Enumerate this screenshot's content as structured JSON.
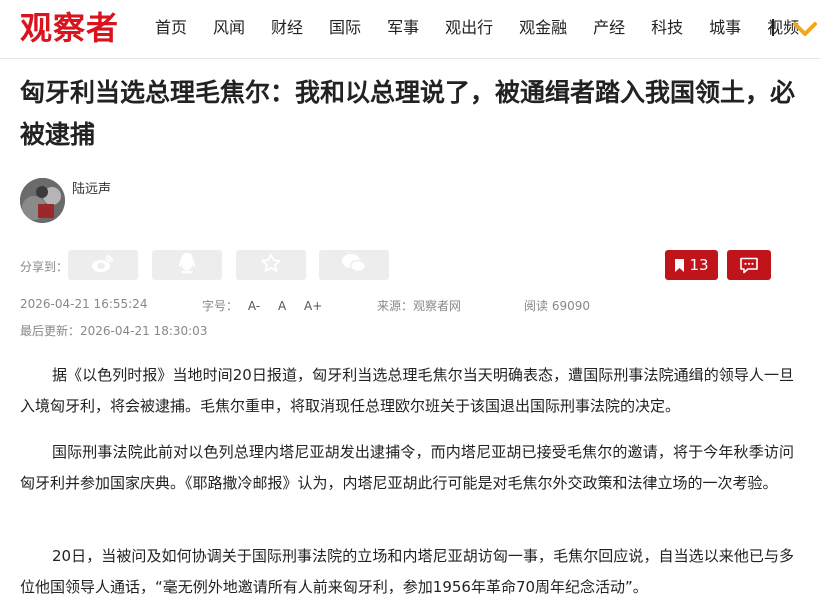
{
  "site": {
    "logo": "观察者"
  },
  "nav": {
    "items": [
      "首页",
      "风闻",
      "财经",
      "国际",
      "军事",
      "观出行",
      "观金融",
      "产经",
      "科技",
      "城事",
      "视频"
    ]
  },
  "article": {
    "title": "匈牙利当选总理毛焦尔：我和以总理说了，被通缉者踏入我国领土，必被逮捕",
    "author": "陆远声",
    "share_label": "分享到：",
    "bookmark_count": "13",
    "publish_time": "2026-04-21 16:55:24",
    "font_size_label": "字号：",
    "font_small": "A-",
    "font_normal": "A",
    "font_large": "A+",
    "source": "来源：观察者网",
    "reads": "阅读 69090",
    "updated": "最后更新：2026-04-21 18:30:03",
    "paragraphs": [
      "据《以色列时报》当地时间20日报道，匈牙利当选总理毛焦尔当天明确表态，遭国际刑事法院通缉的领导人一旦入境匈牙利，将会被逮捕。毛焦尔重申，将取消现任总理欧尔班关于该国退出国际刑事法院的决定。",
      "国际刑事法院此前对以色列总理内塔尼亚胡发出逮捕令，而内塔尼亚胡已接受毛焦尔的邀请，将于今年秋季访问匈牙利并参加国家庆典。《耶路撒冷邮报》认为，内塔尼亚胡此行可能是对毛焦尔外交政策和法律立场的一次考验。",
      "20日，当被问及如何协调关于国际刑事法院的立场和内塔尼亚胡访匈一事，毛焦尔回应说，自当选以来他已与多位他国领导人通话，“毫无例外地邀请所有人前来匈牙利，参加1956年革命70周年纪念活动”。"
    ]
  },
  "icons": [
    "chevron-down-icon",
    "weibo-icon",
    "qq-icon",
    "star-icon",
    "wechat-icon",
    "bookmark-icon",
    "comment-icon"
  ],
  "colors": {
    "brand_red": "#d9141e",
    "button_red": "#c0141b",
    "chevron_yellow": "#f0a81a"
  }
}
